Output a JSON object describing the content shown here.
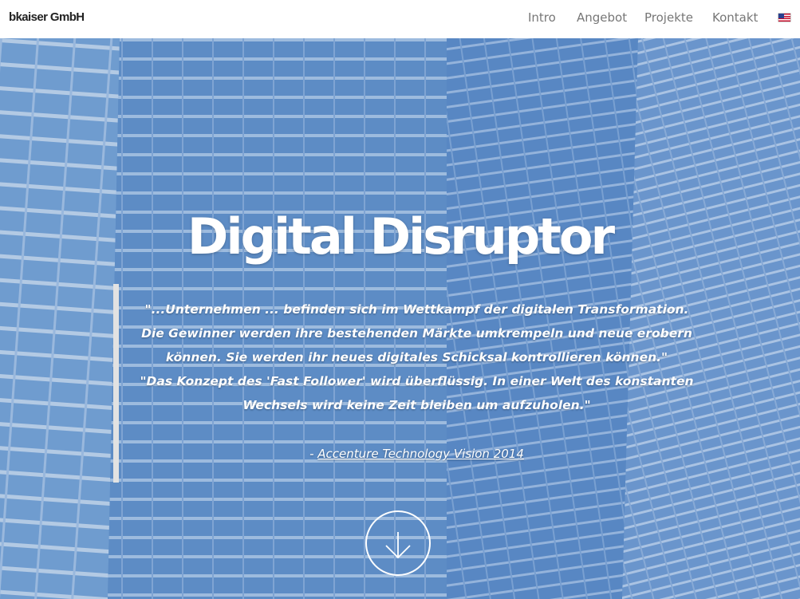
{
  "brand": "bkaiser GmbH",
  "nav": {
    "items": [
      {
        "label": "Intro"
      },
      {
        "label": "Angebot"
      },
      {
        "label": "Projekte"
      },
      {
        "label": "Kontakt"
      }
    ],
    "language_icon": "us-flag-icon"
  },
  "hero": {
    "title": "Digital Disruptor",
    "quote_lines": [
      "\"...Unternehmen ... befinden sich im Wettkampf der digitalen Transformation. Die Gewinner werden ihre bestehenden Märkte umkrempeln und neue erobern können. Sie werden ihr neues digitales Schicksal kontrollieren können.\"",
      "\"Das Konzept des 'Fast Follower' wird überflüssig. In einer Welt des konstanten Wechsels wird keine Zeit bleiben um aufzuholen.\""
    ],
    "source_prefix": "- ",
    "source_link": "Accenture Technology Vision 2014",
    "scroll_icon": "arrow-down-circle-icon"
  },
  "colors": {
    "hero_blue": "#5d8fcb",
    "nav_text": "#777777",
    "brand_text": "#222222"
  }
}
